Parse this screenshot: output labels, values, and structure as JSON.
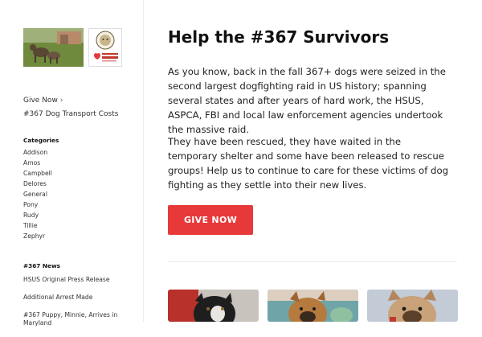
{
  "sidebar": {
    "logo_text": "JASMINE'S HOUSE",
    "nav_links": [
      {
        "label": "Give Now",
        "suffix": "›"
      },
      {
        "label": "#367 Dog Transport Costs",
        "suffix": ""
      }
    ],
    "categories": {
      "title": "Categories",
      "items": [
        "Addison",
        "Amos",
        "Campbell",
        "Delores",
        "General",
        "Pony",
        "Rudy",
        "Tillie",
        "Zephyr"
      ]
    },
    "news": {
      "title": "#367 News",
      "items": [
        "HSUS Original Press Release",
        "Additional Arrest Made",
        "#367 Puppy, Minnie, Arrives in Maryland"
      ]
    }
  },
  "main": {
    "title": "Help the #367 Survivors",
    "paragraphs": [
      "As you know, back in the fall 367+ dogs were seized in the second largest  dogfighting raid in US history; spanning several states and after years of hard work, the HSUS, ASPCA, FBI and local law enforcement agencies undertook the massive raid.",
      "They have been rescued, they have waited in the temporary shelter and some have been released to rescue groups! Help us to continue to care for these victims of dog fighting as they settle into their new lives."
    ],
    "give_button": "GIVE NOW"
  },
  "colors": {
    "accent": "#e8393a",
    "divider": "#ececec"
  }
}
